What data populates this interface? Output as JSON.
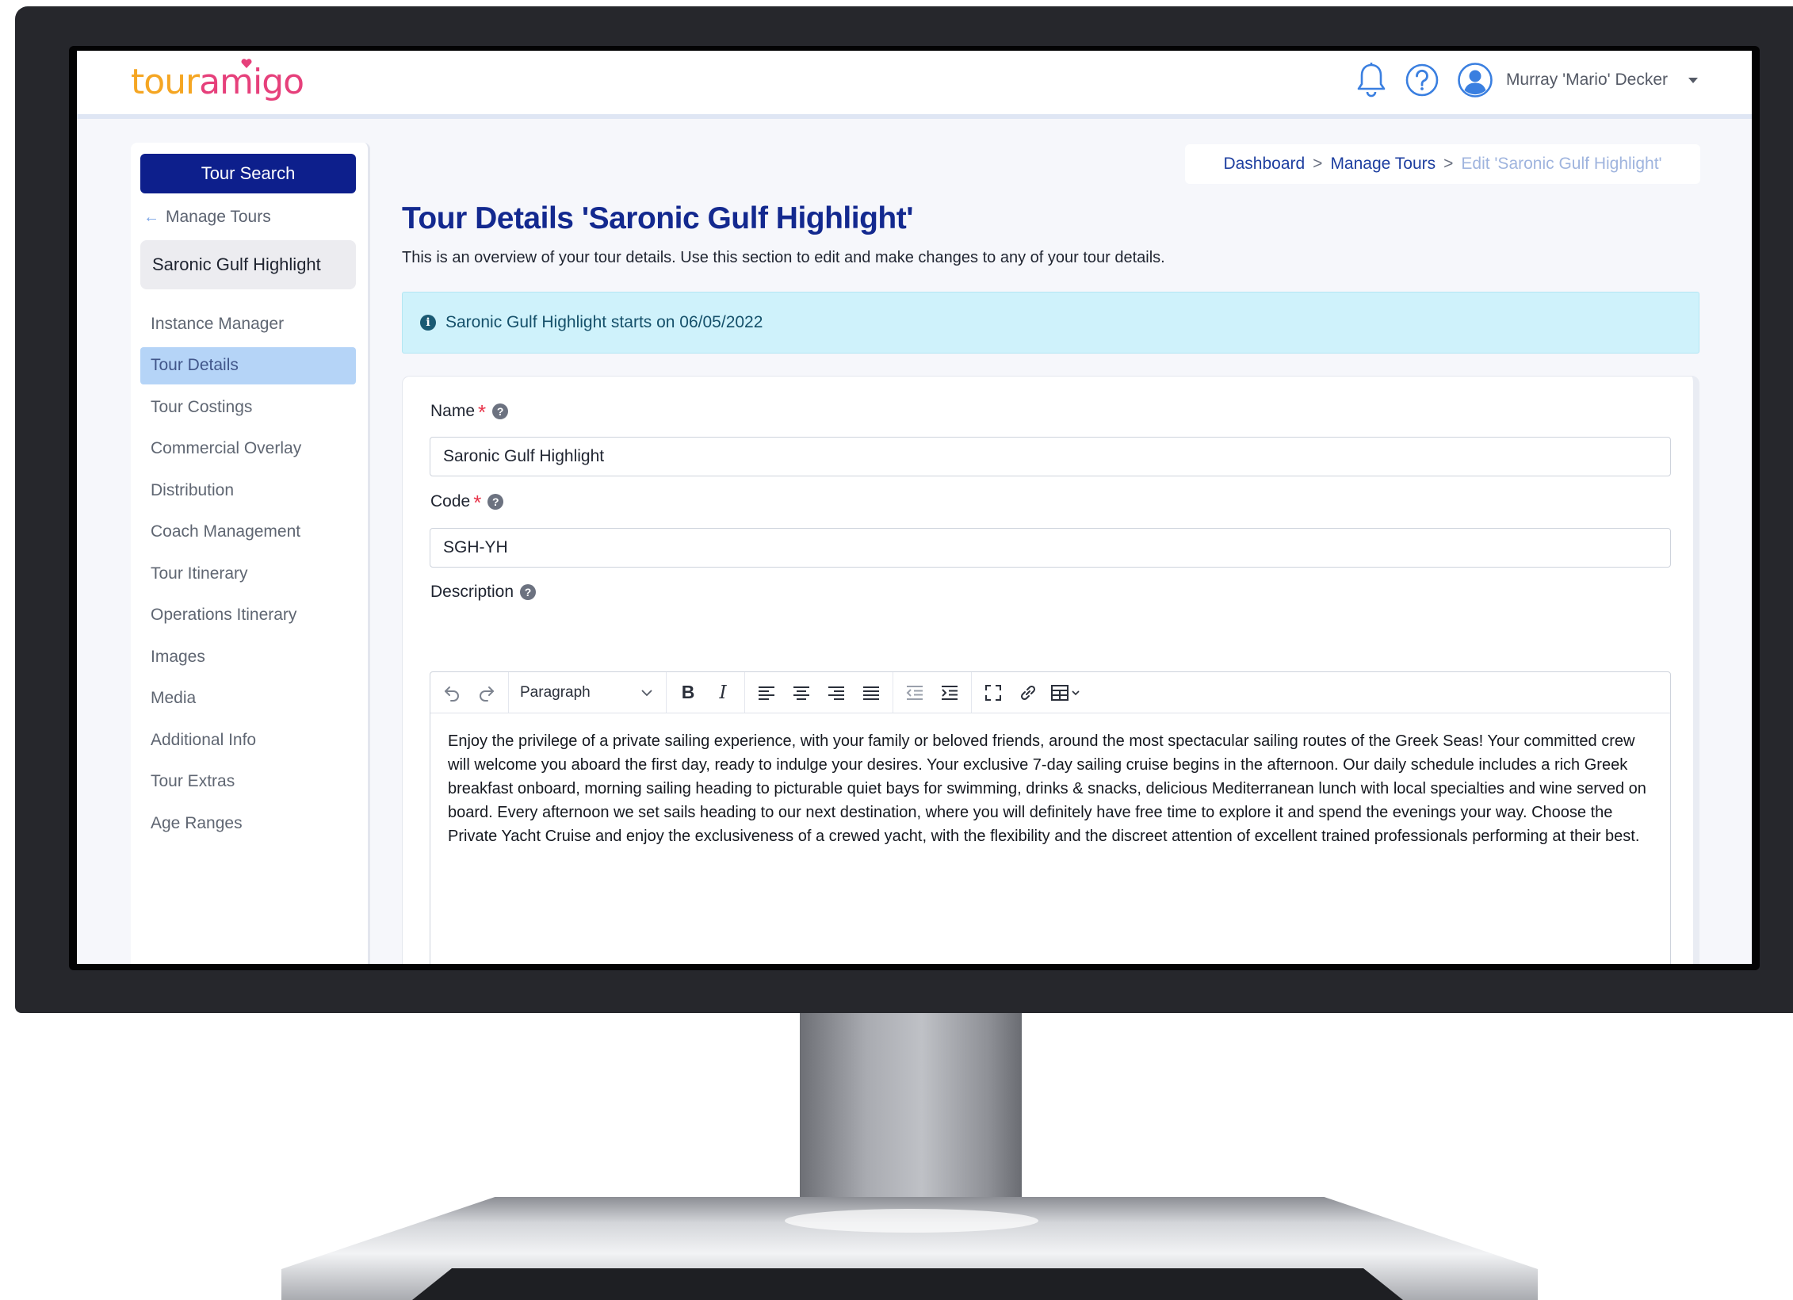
{
  "app": {
    "logo_part1": "tour",
    "logo_part2": "amigo",
    "user_name": "Murray 'Mario' Decker"
  },
  "icons": {
    "notifications": "bell-icon",
    "help": "question-circle-icon",
    "avatar": "user-circle-icon",
    "user_menu": "caret-down-icon"
  },
  "sidebar": {
    "tour_search_label": "Tour Search",
    "back_label": "Manage Tours",
    "current_tour": "Saronic Gulf Highlight",
    "items": [
      {
        "label": "Instance Manager"
      },
      {
        "label": "Tour Details"
      },
      {
        "label": "Tour Costings"
      },
      {
        "label": "Commercial Overlay"
      },
      {
        "label": "Distribution"
      },
      {
        "label": "Coach Management"
      },
      {
        "label": "Tour Itinerary"
      },
      {
        "label": "Operations Itinerary"
      },
      {
        "label": "Images"
      },
      {
        "label": "Media"
      },
      {
        "label": "Additional Info"
      },
      {
        "label": "Tour Extras"
      },
      {
        "label": "Age Ranges"
      }
    ],
    "active_item": "Tour Details"
  },
  "breadcrumb": {
    "items": [
      "Dashboard",
      "Manage Tours"
    ],
    "current": "Edit 'Saronic Gulf Highlight'",
    "separator": ">"
  },
  "page": {
    "title": "Tour Details 'Saronic Gulf Highlight'",
    "description": "This is an overview of your tour details. Use this section to edit and make changes to any of your tour details.",
    "info_banner": "Saronic Gulf Highlight starts on 06/05/2022"
  },
  "form": {
    "name_label": "Name",
    "name_value": "Saronic Gulf Highlight",
    "code_label": "Code",
    "code_value": "SGH-YH",
    "description_label": "Description",
    "required_marker": "*",
    "editor": {
      "block_format": "Paragraph",
      "content": "Enjoy the privilege of a private sailing experience, with your family or beloved friends, around the most spectacular sailing routes of the Greek Seas! Your committed crew will welcome you aboard the first day, ready to indulge your desires. Your exclusive 7-day sailing cruise begins in the afternoon. Our daily schedule includes a rich Greek breakfast onboard, morning sailing heading to picturable quiet bays for swimming, drinks & snacks, delicious Mediterranean lunch with local specialties and wine served on board. Every afternoon we set sails heading to our next destination, where you will definitely have free time to explore it and spend the evenings your way. Choose the Private Yacht Cruise and enjoy the exclusiveness of a crewed yacht, with the flexibility and the discreet attention of excellent trained professionals performing at their best."
    }
  },
  "colors": {
    "primary": "#0d1f8c",
    "logo_orange": "#f5a623",
    "logo_pink": "#e6407b",
    "banner_bg": "#cff2fb",
    "active_nav": "#b5d4f7",
    "required": "#e8344a"
  }
}
